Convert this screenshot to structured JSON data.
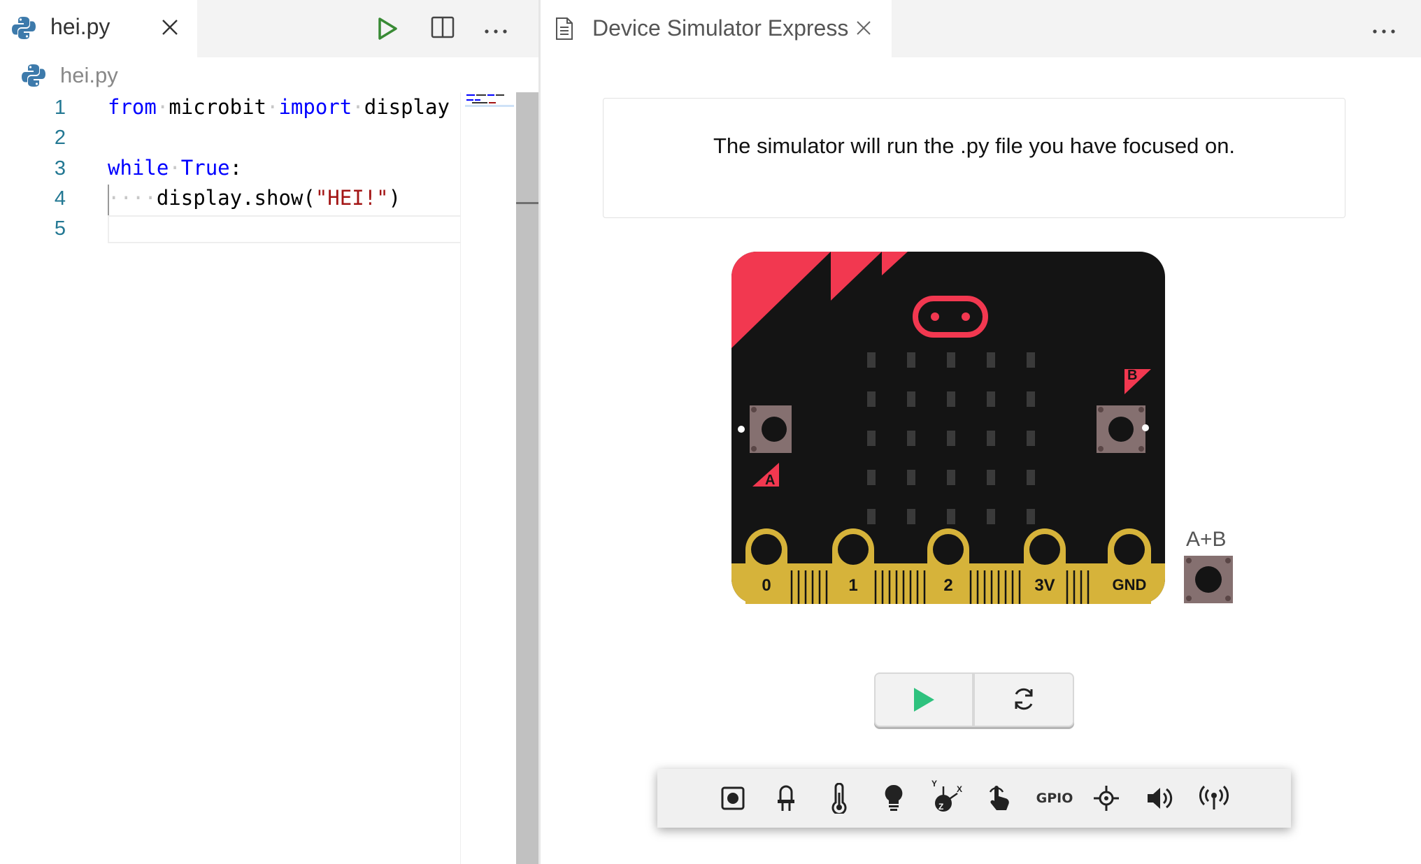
{
  "editor": {
    "tab": {
      "label": "hei.py",
      "icon": "python-icon"
    },
    "breadcrumb": "hei.py",
    "line_numbers": [
      "1",
      "2",
      "3",
      "4",
      "5"
    ],
    "code": {
      "l1": {
        "k1": "from",
        "t1": "microbit",
        "k2": "import",
        "t2": "display"
      },
      "l3": {
        "k1": "while",
        "k2": "True",
        "t1": ":"
      },
      "l4": {
        "indent": "····",
        "t1": "display.show(",
        "s1": "\"HEI!\"",
        "t2": ")"
      }
    },
    "colors": {
      "keyword": "#0000ff",
      "string": "#a31515",
      "line_number": "#237893"
    }
  },
  "simulator": {
    "tab": {
      "label": "Device Simulator Express",
      "icon": "document-icon"
    },
    "notice": "The simulator will run the .py file you have focused on.",
    "board": {
      "button_a": "A",
      "button_b": "B",
      "pins": [
        "0",
        "1",
        "2",
        "3V",
        "GND"
      ],
      "ab_label": "A+B",
      "colors": {
        "body": "#141414",
        "accent": "#f23850",
        "edge": "#d6b33a"
      }
    },
    "toolbar": {
      "items": [
        "push-button-icon",
        "led-icon",
        "thermometer-icon",
        "light-bulb-icon",
        "accelerometer-icon",
        "touch-icon",
        "GPIO",
        "compass-icon",
        "speaker-icon",
        "radio-icon"
      ],
      "gpio_label": "GPIO",
      "accel_axes": {
        "x": "X",
        "y": "Y",
        "z": "Z"
      }
    },
    "colors": {
      "play": "#2ec27e"
    }
  }
}
